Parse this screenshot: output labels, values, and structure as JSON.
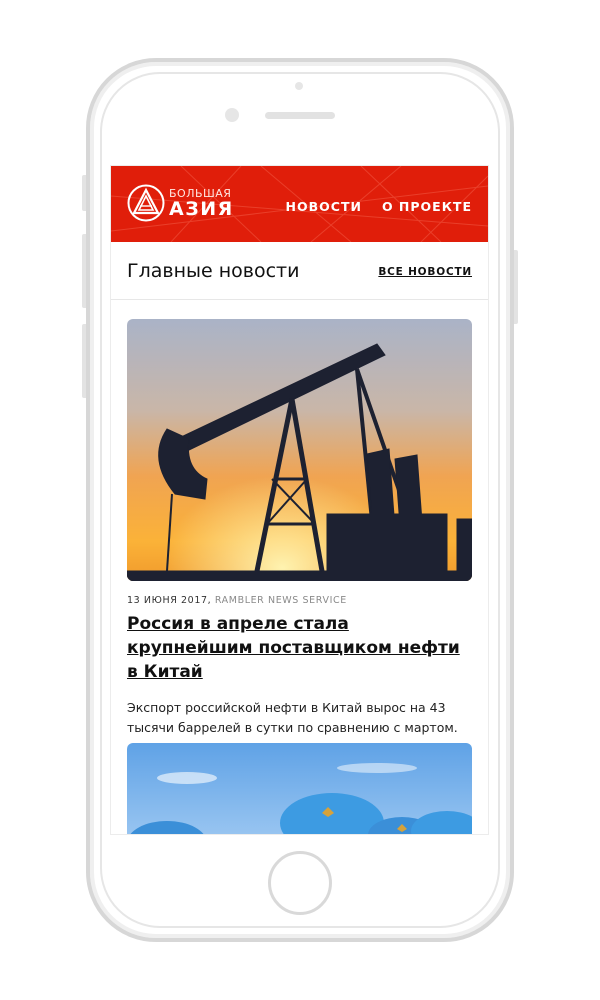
{
  "brand": {
    "name_small": "Большая",
    "name_big": "АЗИЯ",
    "accent_color": "#e01e0a"
  },
  "nav": {
    "items": [
      {
        "label": "Новости"
      },
      {
        "label": "О проекте"
      }
    ]
  },
  "section": {
    "title": "Главные новости",
    "all_news_link": "Все новости"
  },
  "articles": [
    {
      "date": "13 июня 2017,",
      "source": "RAMBLER NEWS SERVICE",
      "title": "Россия в апреле стала крупнейшим поставщиком нефти в Китай",
      "lead": "Экспорт российской нефти в Китай вырос на 43 тысячи баррелей в сутки по сравнению с мартом.",
      "image": "oil-pump-jack-sunset"
    },
    {
      "image": "crowd-blue-caps"
    }
  ],
  "icons": {
    "logo": "triangle-in-circle-logo"
  }
}
